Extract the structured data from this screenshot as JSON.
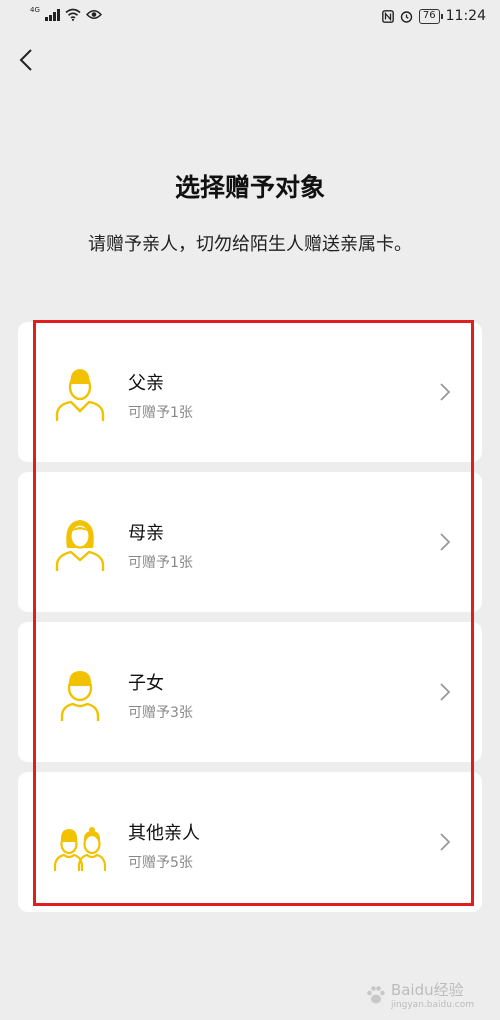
{
  "status_bar": {
    "network": "4G",
    "battery": "76",
    "time": "11:24"
  },
  "header": {
    "title": "选择赠予对象",
    "subtitle": "请赠予亲人，切勿给陌生人赠送亲属卡。"
  },
  "recipients": [
    {
      "name": "父亲",
      "quota": "可赠予1张",
      "icon": "father-avatar-icon"
    },
    {
      "name": "母亲",
      "quota": "可赠予1张",
      "icon": "mother-avatar-icon"
    },
    {
      "name": "子女",
      "quota": "可赠予3张",
      "icon": "child-avatar-icon"
    },
    {
      "name": "其他亲人",
      "quota": "可赠予5张",
      "icon": "family-avatar-icon"
    }
  ],
  "watermark": {
    "text": "Baidu经验",
    "sub": "jingyan.baidu.com"
  },
  "colors": {
    "background": "#ededed",
    "card": "#ffffff",
    "icon_accent": "#f2c200",
    "highlight": "#e11e1e"
  }
}
